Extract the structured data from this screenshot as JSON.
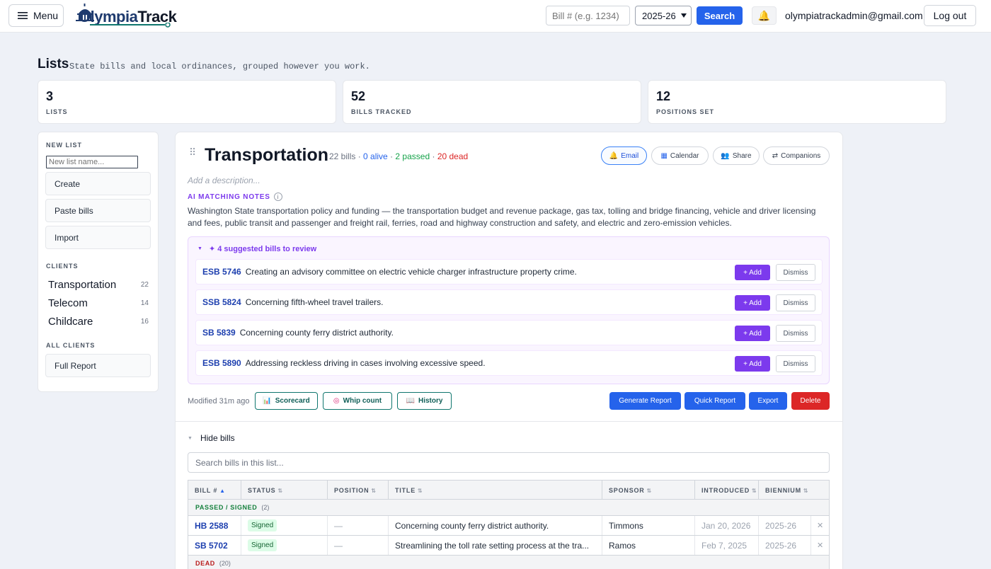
{
  "header": {
    "menu_label": "Menu",
    "logo_part1": "Olympia",
    "logo_part2": "Track",
    "bill_placeholder": "Bill # (e.g. 1234)",
    "year_value": "2025-26",
    "search_label": "Search",
    "user_email": "olympiatrackadmin@gmail.com",
    "logout_label": "Log out"
  },
  "page": {
    "title": "Lists",
    "subtitle": "State bills and local ordinances, grouped however you work."
  },
  "stats": [
    {
      "value": "3",
      "label": "LISTS"
    },
    {
      "value": "52",
      "label": "BILLS TRACKED"
    },
    {
      "value": "12",
      "label": "POSITIONS SET"
    }
  ],
  "sidebar": {
    "new_list_heading": "NEW LIST",
    "new_list_placeholder": "New list name...",
    "buttons": [
      "Create",
      "Paste bills",
      "Import"
    ],
    "clients_heading": "CLIENTS",
    "clients": [
      {
        "name": "Transportation",
        "count": "22"
      },
      {
        "name": "Telecom",
        "count": "14"
      },
      {
        "name": "Childcare",
        "count": "16"
      }
    ],
    "all_clients_heading": "ALL CLIENTS",
    "full_report_label": "Full Report"
  },
  "list": {
    "title": "Transportation",
    "bill_count": "22 bills",
    "sep1": "·",
    "alive": "0 alive",
    "sep2": "·",
    "passed": "2 passed",
    "sep3": "·",
    "dead": "20 dead",
    "pills": [
      "Email",
      "Calendar",
      "Share",
      "Companions"
    ],
    "description_placeholder": "Add a description...",
    "ai_heading": "AI MATCHING NOTES",
    "ai_notes": "Washington State transportation policy and funding — the transportation budget and revenue package, gas tax, tolling and bridge financing, vehicle and driver licensing and fees, public transit and passenger and freight rail, ferries, road and highway construction and safety, and electric and zero-emission vehicles.",
    "suggestions_heading": "✦ 4 suggested bills to review",
    "suggestions": [
      {
        "bill": "ESB 5746",
        "title": "Creating an advisory committee on electric vehicle charger infrastructure property crime."
      },
      {
        "bill": "SSB 5824",
        "title": "Concerning fifth-wheel travel trailers."
      },
      {
        "bill": "SB 5839",
        "title": "Concerning county ferry district authority."
      },
      {
        "bill": "ESB 5890",
        "title": "Addressing reckless driving in cases involving excessive speed."
      }
    ],
    "add_label": "+ Add",
    "dismiss_label": "Dismiss",
    "modified": "Modified 31m ago",
    "tools": [
      "Scorecard",
      "Whip count",
      "History"
    ],
    "actions": [
      "Generate Report",
      "Quick Report",
      "Export",
      "Delete"
    ],
    "hide_bills_label": "Hide bills",
    "search_placeholder": "Search bills in this list..."
  },
  "table": {
    "columns": [
      "BILL #",
      "STATUS",
      "POSITION",
      "TITLE",
      "SPONSOR",
      "INTRODUCED",
      "BIENNIUM"
    ],
    "groups": [
      {
        "label": "PASSED / SIGNED",
        "count": "(2)"
      },
      {
        "label": "DEAD",
        "count": "(20)"
      }
    ],
    "rows": [
      {
        "bill": "HB 2588",
        "status": "Signed",
        "position": "—",
        "title": "Concerning county ferry district authority.",
        "sponsor": "Timmons",
        "introduced": "Jan 20, 2026",
        "biennium": "2025-26"
      },
      {
        "bill": "SB 5702",
        "status": "Signed",
        "position": "—",
        "title": "Streamlining the toll rate setting process at the tra...",
        "sponsor": "Ramos",
        "introduced": "Feb 7, 2025",
        "biennium": "2025-26"
      }
    ]
  },
  "colors": {
    "primary": "#2563eb",
    "purple": "#7c3aed",
    "danger": "#dc2626",
    "teal": "#0f766e",
    "passed": "#15803d"
  }
}
